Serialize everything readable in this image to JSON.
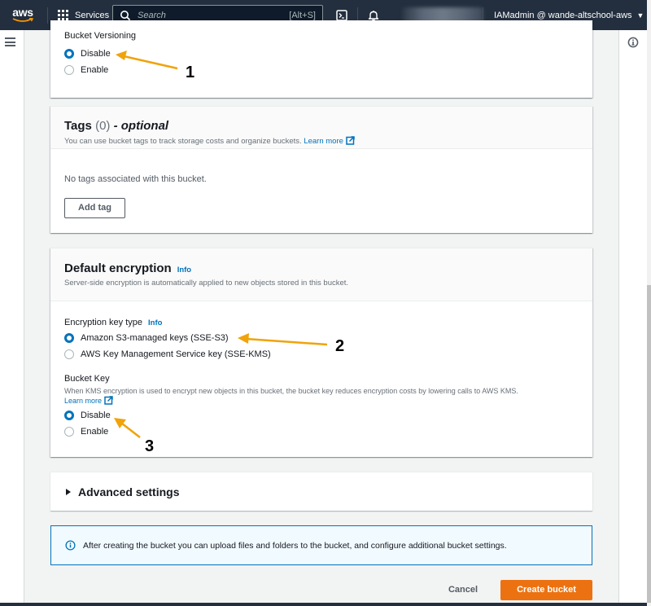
{
  "topnav": {
    "logo_text": "aws",
    "services_label": "Services",
    "search_placeholder": "Search",
    "search_shortcut": "[Alt+S]",
    "user_label": "IAMadmin @ wande-altschool-aws"
  },
  "versioning": {
    "label": "Bucket Versioning",
    "options": [
      {
        "label": "Disable",
        "checked": true
      },
      {
        "label": "Enable",
        "checked": false
      }
    ]
  },
  "tags": {
    "title": "Tags",
    "count": "(0)",
    "optional": "- optional",
    "description": "You can use bucket tags to track storage costs and organize buckets.",
    "learn_more": "Learn more",
    "empty_text": "No tags associated with this bucket.",
    "add_tag_label": "Add tag"
  },
  "encryption": {
    "title": "Default encryption",
    "info_label": "Info",
    "description": "Server-side encryption is automatically applied to new objects stored in this bucket.",
    "key_type_label": "Encryption key type",
    "key_type_info": "Info",
    "key_type_options": [
      {
        "label": "Amazon S3-managed keys (SSE-S3)",
        "checked": true
      },
      {
        "label": "AWS Key Management Service key (SSE-KMS)",
        "checked": false
      }
    ],
    "bucket_key_label": "Bucket Key",
    "bucket_key_desc": "When KMS encryption is used to encrypt new objects in this bucket, the bucket key reduces encryption costs by lowering calls to AWS KMS.",
    "bucket_key_learn_more": "Learn more",
    "bucket_key_options": [
      {
        "label": "Disable",
        "checked": true
      },
      {
        "label": "Enable",
        "checked": false
      }
    ]
  },
  "advanced": {
    "label": "Advanced settings",
    "expanded": false
  },
  "alert": {
    "text": "After creating the bucket you can upload files and folders to the bucket, and configure additional bucket settings."
  },
  "footer": {
    "cancel_label": "Cancel",
    "create_label": "Create bucket"
  },
  "annotations": [
    {
      "number": "1",
      "target": "Bucket Versioning: Disable"
    },
    {
      "number": "2",
      "target": "Amazon S3-managed keys (SSE-S3)"
    },
    {
      "number": "3",
      "target": "Bucket Key: Disable"
    }
  ],
  "colors": {
    "nav_bg": "#232f3e",
    "primary_button": "#ec7211",
    "link": "#0073bb",
    "annotation_arrow": "#f0a30a"
  }
}
